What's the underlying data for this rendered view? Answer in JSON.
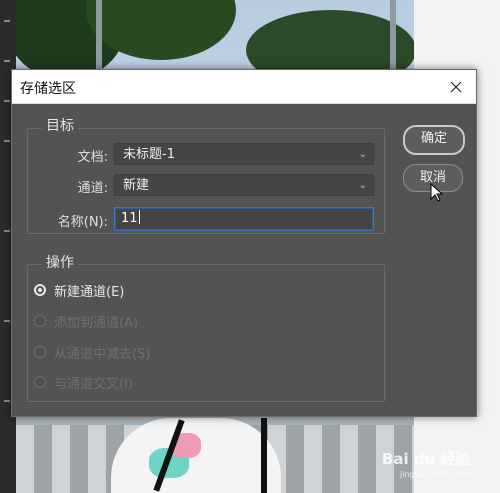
{
  "dialog": {
    "title": "存储选区",
    "close_icon": "close-icon"
  },
  "target": {
    "legend": "目标",
    "document_label": "文档:",
    "document_value": "未标题-1",
    "channel_label": "通道:",
    "channel_value": "新建",
    "name_label": "名称(N):",
    "name_value": "11"
  },
  "operation": {
    "legend": "操作",
    "options": [
      {
        "label": "新建通道(E)",
        "checked": true,
        "enabled": true
      },
      {
        "label": "添加到通道(A)",
        "checked": false,
        "enabled": false
      },
      {
        "label": "从通道中减去(S)",
        "checked": false,
        "enabled": false
      },
      {
        "label": "与通道交叉(I)",
        "checked": false,
        "enabled": false
      }
    ]
  },
  "buttons": {
    "ok_label": "确定",
    "cancel_label": "取消"
  },
  "watermark": {
    "brand": "Bai du 经验",
    "url": "jingyan.baidu.com"
  },
  "colors": {
    "dialog_bg": "#535353",
    "input_focus": "#3a76b8"
  }
}
